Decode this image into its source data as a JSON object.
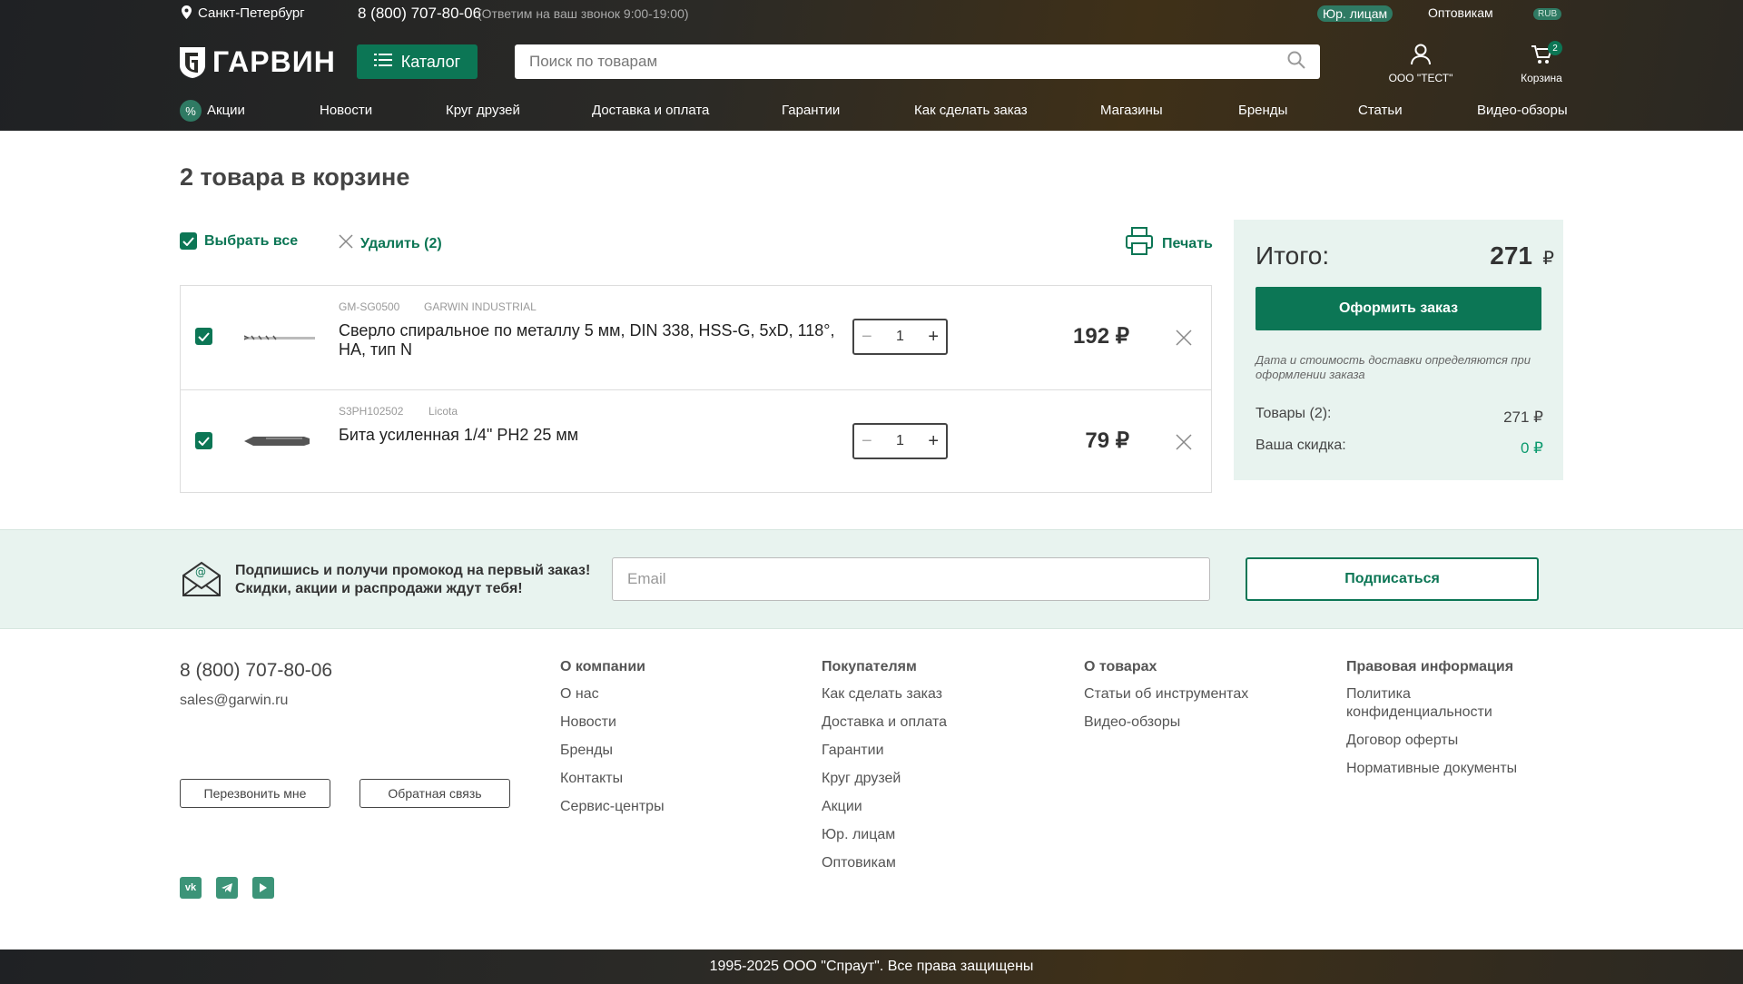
{
  "header": {
    "city": "Санкт-Петербург",
    "phone": "8 (800) 707-80-06",
    "phone_note": "(Ответим на ваш звонок 9:00-19:00)",
    "legal_link": "Юр. лицам",
    "wholesale_link": "Оптовикам",
    "currency": "RUB",
    "logo_text": "ГАРВИН",
    "catalog_label": "Каталог",
    "search_placeholder": "Поиск по товарам",
    "account_label": "ООО \"ТЕСТ\"",
    "cart_label": "Корзина",
    "cart_count": "2"
  },
  "nav": [
    "Акции",
    "Новости",
    "Круг друзей",
    "Доставка и оплата",
    "Гарантии",
    "Как сделать заказ",
    "Магазины",
    "Бренды",
    "Статьи",
    "Видео-обзоры"
  ],
  "cart": {
    "heading": "2 товара в корзине",
    "select_all": "Выбрать все",
    "delete": "Удалить (2)",
    "print": "Печать",
    "items": [
      {
        "sku": "GM-SG0500",
        "brand": "GARWIN INDUSTRIAL",
        "title": "Сверло спиральное по металлу 5 мм, DIN 338, HSS-G, 5xD, 118°, НА, тип N",
        "qty": "1",
        "price": "192 ₽"
      },
      {
        "sku": "S3PH102502",
        "brand": "Licota",
        "title": "Бита усиленная 1/4\" PH2 25 мм",
        "qty": "1",
        "price": "79 ₽"
      }
    ]
  },
  "summary": {
    "total_label": "Итого:",
    "total_value": "271",
    "currency": "₽",
    "checkout": "Оформить заказ",
    "note": "Дата и стоимость доставки определяются при оформлении заказа",
    "goods_label": "Товары (2):",
    "goods_value": "271 ₽",
    "discount_label": "Ваша скидка:",
    "discount_value": "0 ₽"
  },
  "subscribe": {
    "line1": "Подпишись и получи промокод на первый заказ!",
    "line2": "Скидки, акции и распродажи ждут тебя!",
    "placeholder": "Email",
    "button": "Подписаться"
  },
  "footer": {
    "phone": "8 (800) 707-80-06",
    "email": "sales@garwin.ru",
    "callback": "Перезвонить мне",
    "feedback": "Обратная связь",
    "columns": [
      {
        "title": "О компании",
        "links": [
          "О нас",
          "Новости",
          "Бренды",
          "Контакты",
          "Сервис-центры"
        ]
      },
      {
        "title": "Покупателям",
        "links": [
          "Как сделать заказ",
          "Доставка и оплата",
          "Гарантии",
          "Круг друзей",
          "Акции",
          "Юр. лицам",
          "Оптовикам"
        ]
      },
      {
        "title": "О товарах",
        "links": [
          "Статьи об инструментах",
          "Видео-обзоры"
        ]
      },
      {
        "title": "Правовая информация",
        "links": [
          "Политика конфиденциальности",
          "Договор оферты",
          "Нормативные документы"
        ]
      }
    ],
    "social": [
      "vk-icon",
      "telegram-icon",
      "youtube-icon"
    ],
    "copyright": "1995-2025 ООО \"Спраут\". Все права защищены"
  },
  "colors": {
    "accent": "#0c7655",
    "light_bg": "#e8f3ef"
  }
}
